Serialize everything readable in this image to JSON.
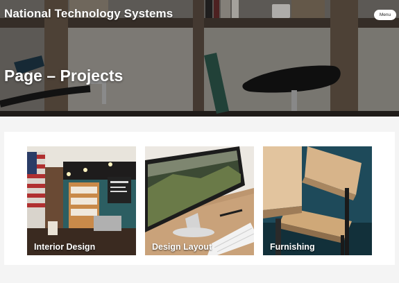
{
  "header": {
    "site_title": "National Technology Systems",
    "menu_label": "Menu"
  },
  "hero": {
    "page_title": "Page – Projects"
  },
  "projects": [
    {
      "label": "Interior Design"
    },
    {
      "label": "Design Layout"
    },
    {
      "label": "Furnishing"
    }
  ]
}
